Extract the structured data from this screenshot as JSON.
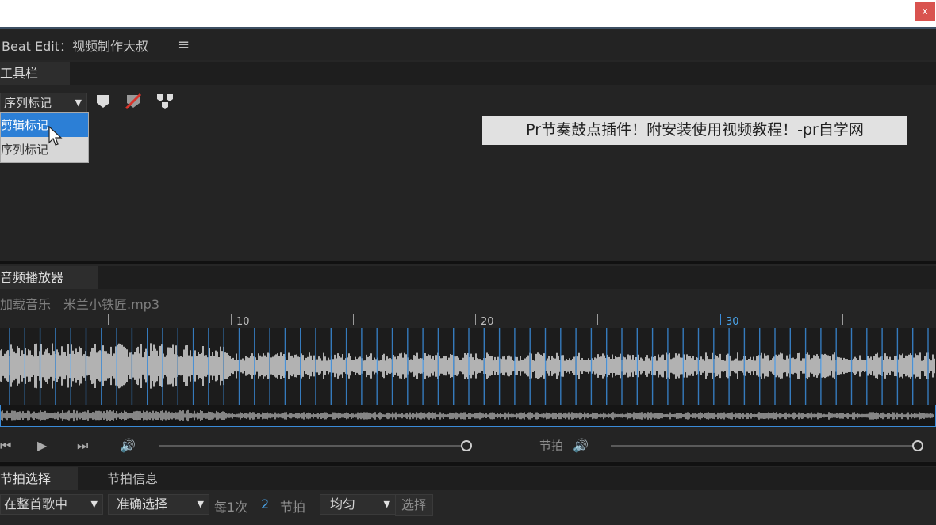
{
  "window": {
    "close_label": "x",
    "title": "Beat Edit：视频制作大叔",
    "menu_icon": "hamburger-menu-icon"
  },
  "toolbar_panel": {
    "tab_label": "工具栏",
    "marker_dropdown": {
      "selected": "序列标记"
    },
    "dropdown_options": [
      "剪辑标记",
      "序列标记"
    ],
    "highlighted_option": "剪辑标记",
    "icons": [
      "add-marker-icon",
      "remove-marker-icon",
      "merge-markers-icon"
    ]
  },
  "banner": {
    "text": "Pr节奏鼓点插件！附安装使用视频教程！-pr自学网"
  },
  "audio_player": {
    "tab_label": "音频播放器",
    "load_label": "加载音乐",
    "file_name": "米兰小铁匠.mp3",
    "ruler_labels": [
      "10",
      "20",
      "30"
    ],
    "beat_label": "节拍",
    "accent_color": "#3a8bd8"
  },
  "beat_panel": {
    "tabs": [
      "节拍选择",
      "节拍信息"
    ],
    "scope_dropdown": "在整首歌中",
    "mode_dropdown": "准确选择",
    "every_label": "每1次",
    "every_value": "2",
    "beats_label": "节拍",
    "distribution_dropdown": "均匀",
    "select_button": "选择"
  }
}
